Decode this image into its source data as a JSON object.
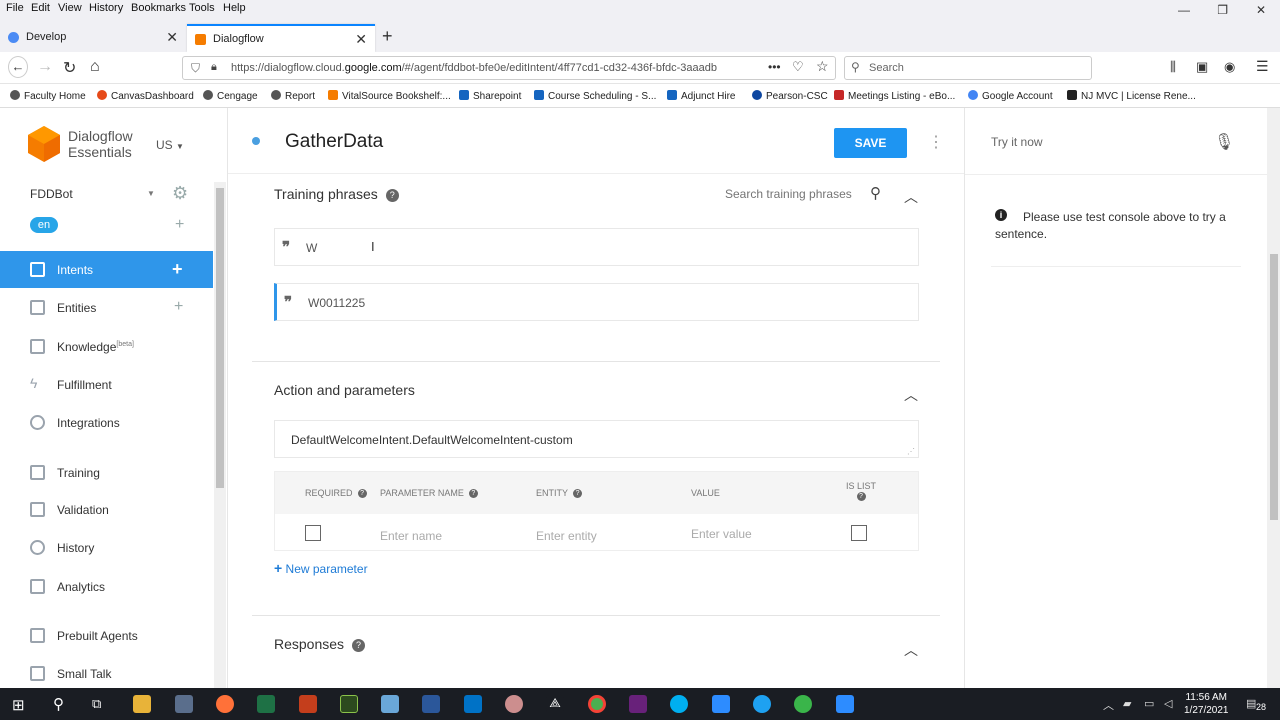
{
  "menubar": [
    "File",
    "Edit",
    "View",
    "History",
    "Bookmarks",
    "Tools",
    "Help"
  ],
  "tabs": [
    {
      "title": "Develop",
      "close": "✕"
    },
    {
      "title": "Dialogflow",
      "close": "✕"
    }
  ],
  "new_tab": "+",
  "url": {
    "prefix": "https://dialogflow.cloud.",
    "domain": "google.com",
    "path": "/#/agent/fddbot-bfe0e/editIntent/4ff77cd1-cd32-436f-bfdc-3aaadb"
  },
  "search": {
    "placeholder": "Search"
  },
  "bookmarks": [
    "Faculty Home",
    "CanvasDashboard",
    "Cengage",
    "Report",
    "VitalSource Bookshelf:...",
    "Sharepoint",
    "Course Scheduling - S...",
    "Adjunct Hire",
    "Pearson-CSC",
    "Meetings Listing - eBo...",
    "Google Account",
    "NJ MVC | License Rene..."
  ],
  "app": {
    "brand_line1": "Dialogflow",
    "brand_line2": "Essentials",
    "region": "US",
    "agent": "FDDBot",
    "language": "en",
    "nav": [
      {
        "label": "Intents"
      },
      {
        "label": "Entities"
      },
      {
        "label": "Knowledge",
        "badge": "[beta]"
      },
      {
        "label": "Fulfillment"
      },
      {
        "label": "Integrations"
      },
      {
        "label": "Training"
      },
      {
        "label": "Validation"
      },
      {
        "label": "History"
      },
      {
        "label": "Analytics"
      },
      {
        "label": "Prebuilt Agents"
      },
      {
        "label": "Small Talk"
      }
    ]
  },
  "intent": {
    "name": "GatherData",
    "save_label": "SAVE",
    "training": {
      "title": "Training phrases",
      "search_placeholder": "Search training phrases",
      "phrases": [
        "W",
        "W0011225"
      ]
    },
    "action": {
      "title": "Action and parameters",
      "action_name": "DefaultWelcomeIntent.DefaultWelcomeIntent-custom",
      "columns": [
        "REQUIRED",
        "PARAMETER NAME",
        "ENTITY",
        "VALUE",
        "IS LIST"
      ],
      "placeholders": {
        "name": "Enter name",
        "entity": "Enter entity",
        "value": "Enter value"
      },
      "new_parameter": "New parameter"
    },
    "responses": {
      "title": "Responses"
    }
  },
  "console": {
    "try_now": "Try it now",
    "notice": "Please use test console above to try a sentence."
  },
  "taskbar": {
    "time": "11:56 AM",
    "date": "1/27/2021",
    "notifications": "28"
  }
}
